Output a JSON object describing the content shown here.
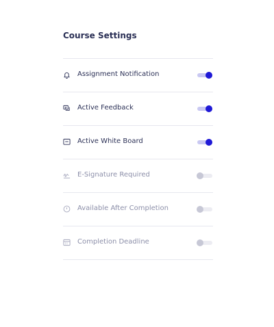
{
  "panel": {
    "title": "Course Settings"
  },
  "settings": [
    {
      "label": "Assignment Notification",
      "icon": "bell-icon",
      "enabled": true
    },
    {
      "label": "Active Feedback",
      "icon": "feedback-icon",
      "enabled": true
    },
    {
      "label": "Active White Board",
      "icon": "whiteboard-icon",
      "enabled": true
    },
    {
      "label": "E-Signature Required",
      "icon": "signature-icon",
      "enabled": false
    },
    {
      "label": "Available After Completion",
      "icon": "clock-icon",
      "enabled": false
    },
    {
      "label": "Completion Deadline",
      "icon": "calendar-icon",
      "enabled": false
    }
  ],
  "colors": {
    "accent": "#1f19d6",
    "accent_track": "#c9c8f2",
    "text_active": "#2a2f55",
    "text_inactive": "#8b8ea8",
    "knob_off": "#c7c8d6",
    "divider": "#e6e7ee"
  }
}
